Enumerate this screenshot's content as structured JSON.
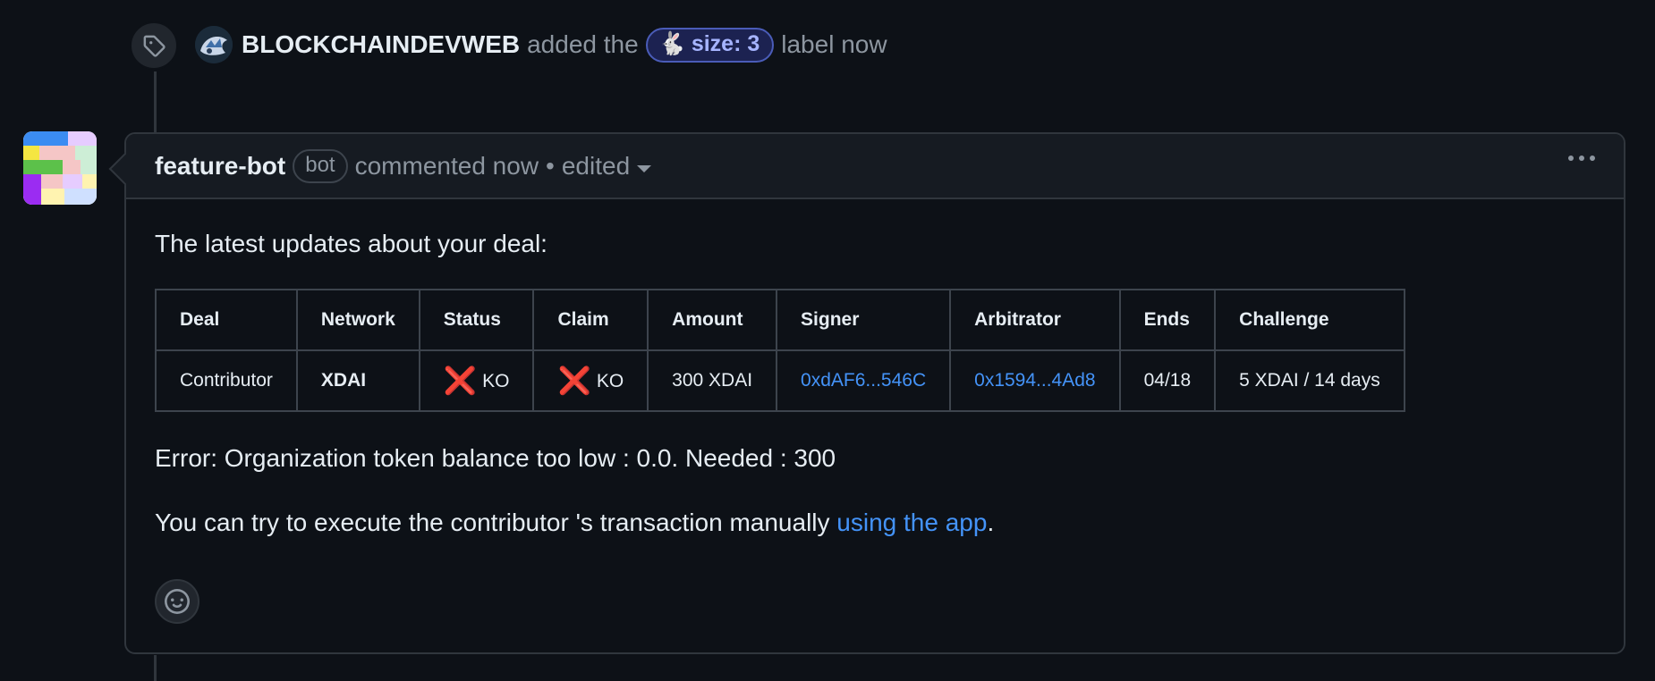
{
  "event": {
    "actor": "BLOCKCHAINDEVWEB",
    "text_before": "added the",
    "label": {
      "emoji": "🐇",
      "text": "size: 3"
    },
    "text_after": "label now",
    "icon": "tag-icon"
  },
  "comment": {
    "author": "feature-bot",
    "badge": "bot",
    "meta": "commented now",
    "separator": "•",
    "edited": "edited",
    "intro": "The latest updates about your deal:",
    "table": {
      "headers": [
        "Deal",
        "Network",
        "Status",
        "Claim",
        "Amount",
        "Signer",
        "Arbitrator",
        "Ends",
        "Challenge"
      ],
      "row": {
        "deal": "Contributor",
        "network": "XDAI",
        "status_icon": "❌",
        "status": "KO",
        "claim_icon": "❌",
        "claim": "KO",
        "amount": "300 XDAI",
        "signer": "0xdAF6...546C",
        "arbitrator": "0x1594...4Ad8",
        "ends": "04/18",
        "challenge": "5 XDAI / 14 days"
      }
    },
    "error": "Error: Organization token balance too low : 0.0. Needed : 300",
    "manual_text": "You can try to execute the contributor 's transaction manually",
    "manual_link": "using the app",
    "manual_end": "."
  },
  "icons": [
    "tag-icon",
    "kebab-menu-icon",
    "smiley-icon",
    "caret-down-icon"
  ],
  "colors": {
    "background": "#0d1117",
    "link": "#4493f8",
    "label_bg": "#1c2251",
    "label_fg": "#a6b4ff",
    "cross": "#e5262d"
  }
}
